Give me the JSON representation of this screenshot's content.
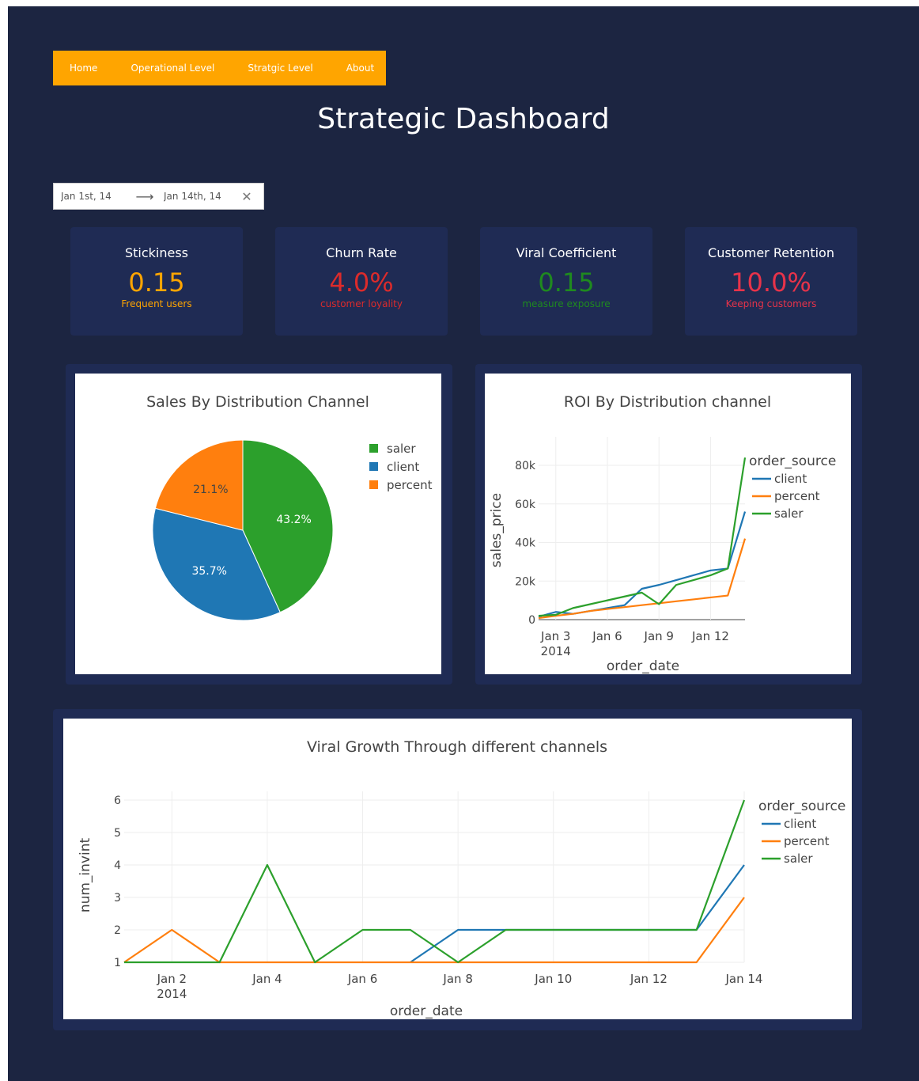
{
  "nav": {
    "items": [
      {
        "label": "Home"
      },
      {
        "label": "Operational Level"
      },
      {
        "label": "Stratgic Level"
      },
      {
        "label": "About"
      }
    ]
  },
  "page": {
    "title": "Strategic Dashboard"
  },
  "date_range": {
    "start": "Jan 1st, 14",
    "end": "Jan 14th, 14",
    "arrow_icon": "arrow-right-icon",
    "clear_icon": "close-icon"
  },
  "kpis": [
    {
      "title": "Stickiness",
      "value": "0.15",
      "subtitle": "Frequent users",
      "color": "#ffa500"
    },
    {
      "title": "Churn Rate",
      "value": "4.0%",
      "subtitle": "customer loyality",
      "color": "#dc2b2b"
    },
    {
      "title": "Viral Coefficient",
      "value": "0.15",
      "subtitle": "measure exposure",
      "color": "#1f8a1f"
    },
    {
      "title": "Customer Retention",
      "value": "10.0%",
      "subtitle": "Keeping customers",
      "color": "#e8334a"
    }
  ],
  "colors": {
    "client": "#1f77b4",
    "percent": "#ff7f0e",
    "saler": "#2ca02c",
    "background": "#1c2541",
    "card": "#1f2b54",
    "accent": "#ffa500"
  },
  "chart_data": [
    {
      "type": "pie",
      "title": "Sales By Distribution Channel",
      "labels": [
        "saler",
        "client",
        "percent"
      ],
      "values": [
        43.2,
        35.7,
        21.1
      ],
      "slice_labels": [
        "43.2%",
        "35.7%",
        "21.1%"
      ],
      "legend": [
        "saler",
        "client",
        "percent"
      ],
      "legend_position": "top-right"
    },
    {
      "type": "line",
      "title": "ROI By Distribution channel",
      "xlabel": "order_date",
      "ylabel": "sales_price",
      "x_ticks": [
        {
          "label": "Jan 3",
          "sub": "2014"
        },
        {
          "label": "Jan 6",
          "sub": ""
        },
        {
          "label": "Jan 9",
          "sub": ""
        },
        {
          "label": "Jan 12",
          "sub": ""
        }
      ],
      "y_ticks": [
        "0",
        "20k",
        "40k",
        "60k",
        "80k"
      ],
      "ylim": [
        0,
        80000
      ],
      "legend_title": "order_source",
      "legend_position": "top-right",
      "grid": true,
      "series": [
        {
          "name": "client",
          "x": [
            "2014-01-02",
            "2014-01-03",
            "2014-01-04",
            "2014-01-05",
            "2014-01-06",
            "2014-01-07",
            "2014-01-08",
            "2014-01-09",
            "2014-01-10",
            "2014-01-11",
            "2014-01-12",
            "2014-01-13",
            "2014-01-14"
          ],
          "y": [
            1500,
            4000,
            3000,
            4500,
            6000,
            7500,
            16000,
            18000,
            20500,
            23000,
            25500,
            26500,
            56000
          ]
        },
        {
          "name": "percent",
          "x": [
            "2014-01-02",
            "2014-01-03",
            "2014-01-04",
            "2014-01-05",
            "2014-01-06",
            "2014-01-07",
            "2014-01-08",
            "2014-01-09",
            "2014-01-10",
            "2014-01-11",
            "2014-01-12",
            "2014-01-13",
            "2014-01-14"
          ],
          "y": [
            800,
            2000,
            3000,
            4500,
            5500,
            6500,
            7500,
            8500,
            9500,
            10500,
            11500,
            12500,
            42000
          ]
        },
        {
          "name": "saler",
          "x": [
            "2014-01-02",
            "2014-01-03",
            "2014-01-04",
            "2014-01-05",
            "2014-01-06",
            "2014-01-07",
            "2014-01-08",
            "2014-01-09",
            "2014-01-10",
            "2014-01-11",
            "2014-01-12",
            "2014-01-13",
            "2014-01-14"
          ],
          "y": [
            2000,
            2500,
            6000,
            8000,
            10000,
            12000,
            14000,
            8000,
            18000,
            20500,
            23000,
            26500,
            84000
          ]
        }
      ]
    },
    {
      "type": "line",
      "title": "Viral Growth Through different channels",
      "xlabel": "order_date",
      "ylabel": "num_invint",
      "x_ticks": [
        {
          "label": "Jan 2",
          "sub": "2014"
        },
        {
          "label": "Jan 4",
          "sub": ""
        },
        {
          "label": "Jan 6",
          "sub": ""
        },
        {
          "label": "Jan 8",
          "sub": ""
        },
        {
          "label": "Jan 10",
          "sub": ""
        },
        {
          "label": "Jan 12",
          "sub": ""
        },
        {
          "label": "Jan 14",
          "sub": ""
        }
      ],
      "y_ticks": [
        "1",
        "2",
        "3",
        "4",
        "5",
        "6"
      ],
      "ylim": [
        1,
        6
      ],
      "legend_title": "order_source",
      "legend_position": "top-right",
      "grid": true,
      "series": [
        {
          "name": "client",
          "x": [
            "2014-01-07",
            "2014-01-08",
            "2014-01-09",
            "2014-01-10",
            "2014-01-11",
            "2014-01-12",
            "2014-01-13",
            "2014-01-14"
          ],
          "y": [
            1,
            2,
            2,
            2,
            2,
            2,
            2,
            4
          ]
        },
        {
          "name": "percent",
          "x": [
            "2014-01-01",
            "2014-01-02",
            "2014-01-03",
            "2014-01-04",
            "2014-01-05",
            "2014-01-06",
            "2014-01-07",
            "2014-01-08",
            "2014-01-09",
            "2014-01-10",
            "2014-01-11",
            "2014-01-12",
            "2014-01-13",
            "2014-01-14"
          ],
          "y": [
            1,
            2,
            1,
            1,
            1,
            1,
            1,
            1,
            1,
            1,
            1,
            1,
            1,
            3
          ]
        },
        {
          "name": "saler",
          "x": [
            "2014-01-01",
            "2014-01-02",
            "2014-01-03",
            "2014-01-04",
            "2014-01-05",
            "2014-01-06",
            "2014-01-07",
            "2014-01-08",
            "2014-01-09",
            "2014-01-10",
            "2014-01-11",
            "2014-01-12",
            "2014-01-13",
            "2014-01-14"
          ],
          "y": [
            1,
            1,
            1,
            4,
            1,
            2,
            2,
            1,
            2,
            2,
            2,
            2,
            2,
            6
          ]
        }
      ]
    }
  ]
}
